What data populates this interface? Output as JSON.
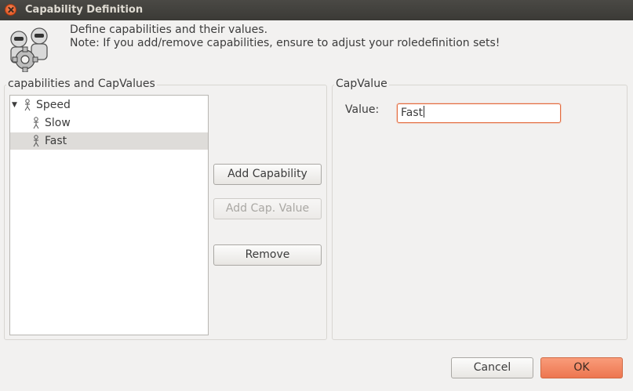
{
  "window": {
    "title": "Capability Definition"
  },
  "header": {
    "line1": "Define capabilities and their values.",
    "line2": "Note: If you add/remove capabilities, ensure to adjust your roledefinition sets!"
  },
  "left_group": {
    "label": "capabilities and CapValues"
  },
  "tree": {
    "root": {
      "label": "Speed",
      "expanded": true
    },
    "children": [
      {
        "label": "Slow",
        "selected": false
      },
      {
        "label": "Fast",
        "selected": true
      }
    ]
  },
  "actions": {
    "add_capability": "Add Capability",
    "add_cap_value": "Add Cap. Value",
    "remove": "Remove"
  },
  "right_group": {
    "label": "CapValue"
  },
  "value_field": {
    "label": "Value:",
    "value": "Fast"
  },
  "footer": {
    "cancel": "Cancel",
    "ok": "OK"
  },
  "colors": {
    "accent": "#ef7b52",
    "focus_border": "#e36b3e",
    "titlebar": "#3c3b37"
  }
}
